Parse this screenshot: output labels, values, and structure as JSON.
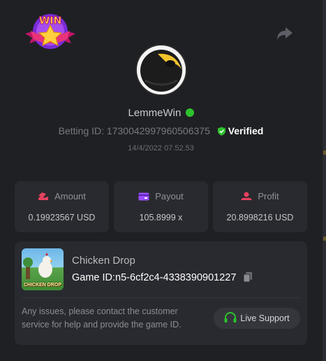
{
  "header": {
    "logo_text": "WIN",
    "share_icon": "share-icon"
  },
  "profile": {
    "username": "LemmeWin",
    "online_icon": "online-dot",
    "betting_id_label": "Betting ID:",
    "betting_id": "1730042997960506375",
    "verified_label": "Verified",
    "date": "14/4/2022 07.52.53"
  },
  "stats": [
    {
      "label": "Amount",
      "value": "0.19923567 USD",
      "icon": "amount-icon",
      "color": "#e8425e"
    },
    {
      "label": "Payout",
      "value": "105.8999 x",
      "icon": "payout-icon",
      "color": "#9b4dff"
    },
    {
      "label": "Profit",
      "value": "20.8998216 USD",
      "icon": "profit-icon",
      "color": "#e8425e"
    }
  ],
  "game": {
    "name": "Chicken Drop",
    "thumb_title": "CHICKEN DROP",
    "id_label": "Game ID:",
    "id_value": "n5-6cf2c4-4338390901227",
    "help_text": "Any issues, please contact the customer service for help and provide the game ID.",
    "live_support_label": "Live Support"
  },
  "colors": {
    "background": "#1f2024",
    "card": "#292a2f",
    "verified_green": "#2dc22d",
    "accent_yellow": "#f5c518"
  }
}
